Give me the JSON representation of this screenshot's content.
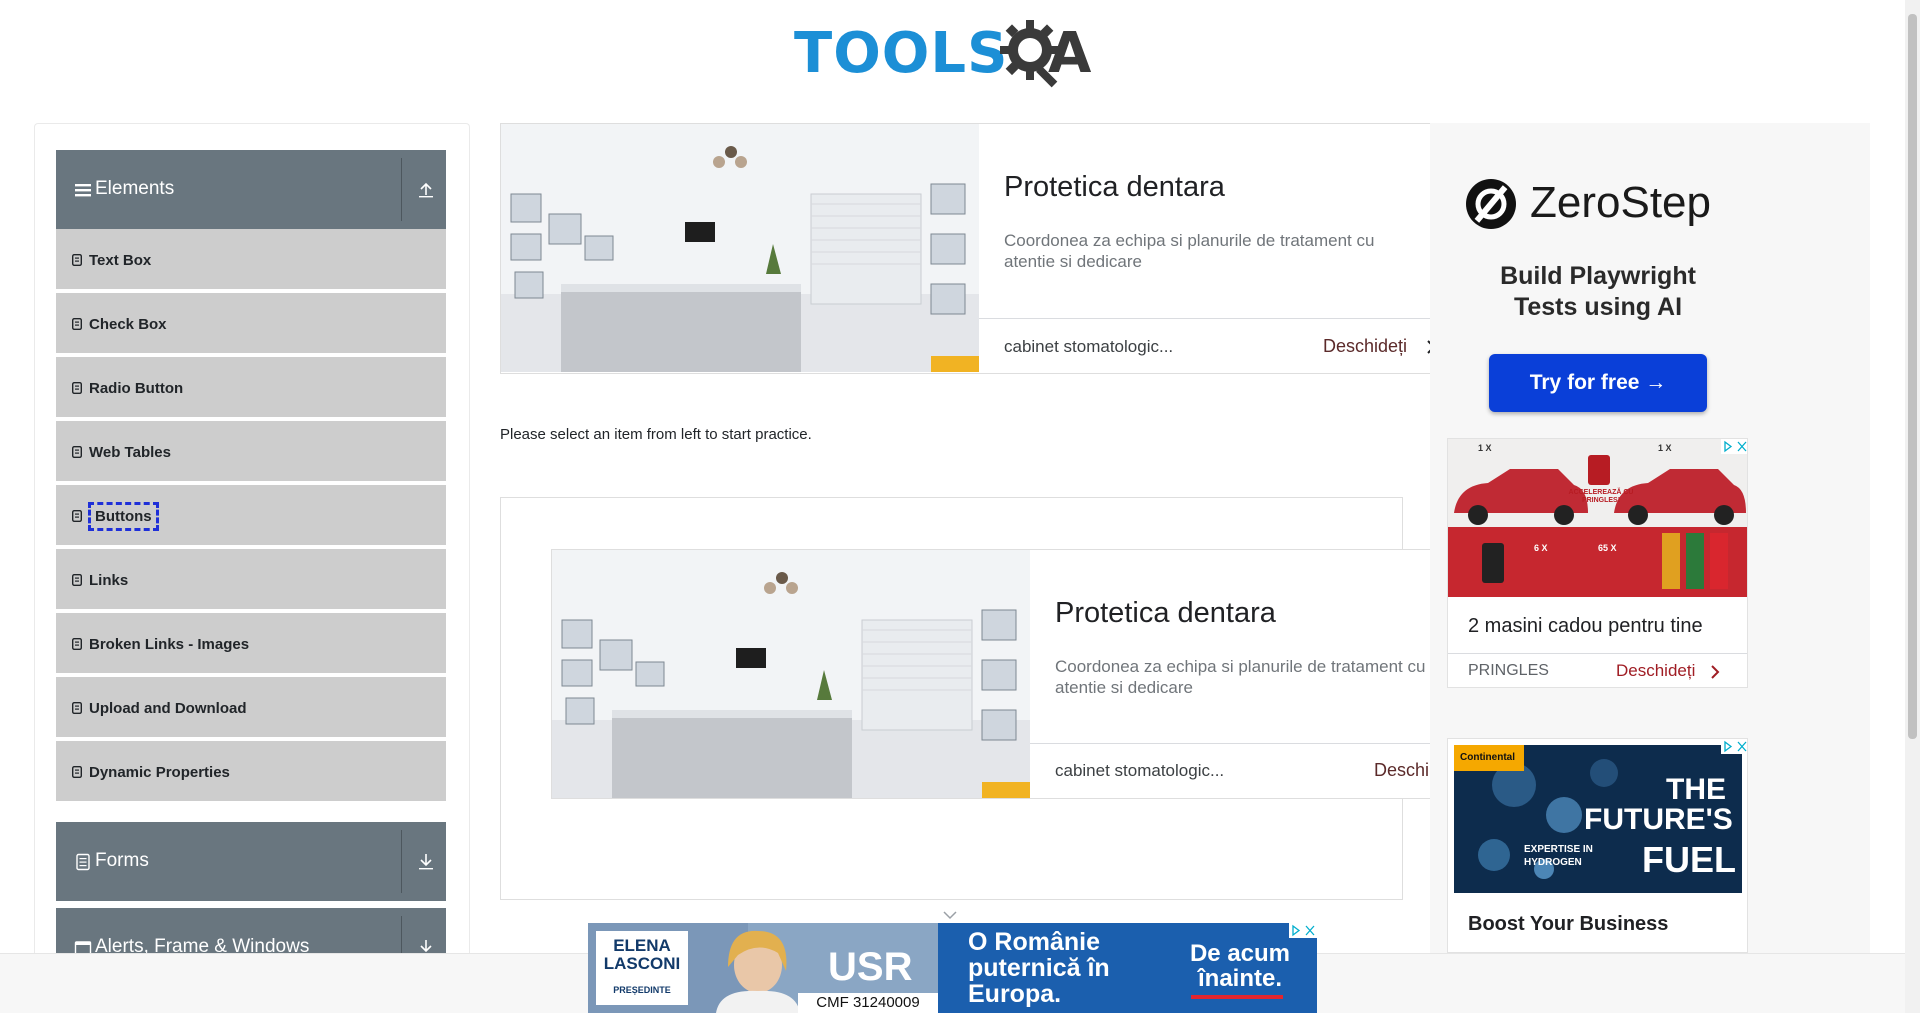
{
  "logo": {
    "word": "TOOLS",
    "qa": "QA"
  },
  "sidebar": {
    "elements_header": "Elements",
    "items": [
      {
        "label": "Text Box"
      },
      {
        "label": "Check Box"
      },
      {
        "label": "Radio Button"
      },
      {
        "label": "Web Tables"
      },
      {
        "label": "Buttons"
      },
      {
        "label": "Links"
      },
      {
        "label": "Broken Links - Images"
      },
      {
        "label": "Upload and Download"
      },
      {
        "label": "Dynamic Properties"
      }
    ],
    "forms_header": "Forms",
    "alerts_header": "Alerts, Frame & Windows"
  },
  "main": {
    "ad_top": {
      "title": "Protetica dentara",
      "description": "Coordonea za echipa si planurile de tratament cu atentie si dedicare",
      "domain": "cabinet stomatologic...",
      "open": "Deschideți"
    },
    "practice_text": "Please select an item from left to start practice.",
    "ad_mid": {
      "title": "Protetica dentara",
      "description": "Coordonea za echipa si planurile de tratament cu atentie si dedicare",
      "domain": "cabinet stomatologic...",
      "open": "Deschi"
    }
  },
  "right": {
    "zerostep": {
      "brand": "ZeroStep",
      "headline": "Build Playwright Tests using AI",
      "cta": "Try for free →"
    },
    "pringles": {
      "title": "2 masini cadou pentru tine",
      "advertiser": "PRINGLES",
      "open": "Deschideți",
      "img_tag1": "1 X",
      "img_tag2": "1 X",
      "img_promo": "ACCELEREAZĂ CU PRINGLES!",
      "img_6x": "6 X",
      "img_65x": "65 X"
    },
    "continental": {
      "brand": "Continental",
      "line1": "THE",
      "line2": "FUTURE'S",
      "line3": "EXPERTISE IN HYDROGEN",
      "line4": "FUEL",
      "title": "Boost Your Business"
    }
  },
  "bottom_ad": {
    "name_first": "ELENA",
    "name_last": "LASCONI",
    "role": "PREȘEDINTE",
    "party": "USR",
    "slogan": "O Românie puternică în Europa.",
    "cta": "De acum înainte.",
    "code": "CMF 31240009"
  },
  "colors": {
    "brand_blue": "#1c8fd6",
    "group_header": "#69767f",
    "menu_item": "#cdcdcd",
    "focus_outline": "#1e2fd8",
    "cta_blue": "#0a3fd8"
  }
}
